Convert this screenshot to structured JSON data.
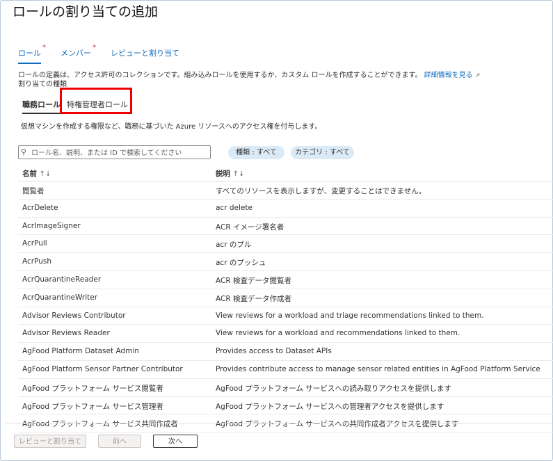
{
  "header": {
    "title": "ロールの割り当ての追加",
    "more": "…"
  },
  "tabs": [
    {
      "label": "ロール",
      "required": "*"
    },
    {
      "label": "メンバー",
      "required": "*"
    },
    {
      "label": "レビューと割り当て",
      "required": ""
    }
  ],
  "description": {
    "text": "ロールの定義は、アクセス許可のコレクションです。組み込みロールを使用するか、カスタム ロールを作成することができます。",
    "link": "詳細情報を見る",
    "link_icon": "external-link-icon"
  },
  "assignment_type_label": "割り当ての種類",
  "subtabs": [
    {
      "label": "職務ロール"
    },
    {
      "label": "特権管理者ロール"
    }
  ],
  "sub_description": "仮想マシンを作成する権限など、職務に基づいた Azure リソースへのアクセス権を付与します。",
  "search": {
    "placeholder": "ロール名、説明、または ID で検索してください",
    "icon": "search-icon"
  },
  "filters": [
    {
      "label": "種類 : すべて"
    },
    {
      "label": "カテゴリ : すべて"
    }
  ],
  "table": {
    "columns": [
      {
        "label": "名前",
        "sort": "↑↓"
      },
      {
        "label": "説明",
        "sort": "↑↓"
      }
    ],
    "rows": [
      {
        "name": "閲覧者",
        "description": "すべてのリソースを表示しますが、変更することはできません。"
      },
      {
        "name": "AcrDelete",
        "description": "acr delete"
      },
      {
        "name": "AcrImageSigner",
        "description": "ACR イメージ署名者"
      },
      {
        "name": "AcrPull",
        "description": "acr のプル"
      },
      {
        "name": "AcrPush",
        "description": "acr のプッシュ"
      },
      {
        "name": "AcrQuarantineReader",
        "description": "ACR 検査データ閲覧者"
      },
      {
        "name": "AcrQuarantineWriter",
        "description": "ACR 検査データ作成者"
      },
      {
        "name": "Advisor Reviews Contributor",
        "description": "View reviews for a workload and triage recommendations linked to them."
      },
      {
        "name": "Advisor Reviews Reader",
        "description": "View reviews for a workload and recommendations linked to them."
      },
      {
        "name": "AgFood Platform Dataset Admin",
        "description": "Provides access to Dataset APIs"
      },
      {
        "name": "AgFood Platform Sensor Partner Contributor",
        "description": "Provides contribute access to manage sensor related entities in AgFood Platform Service"
      },
      {
        "name": "AgFood プラットフォーム サービス閲覧者",
        "description": "AgFood プラットフォーム サービスへの読み取りアクセスを提供します"
      },
      {
        "name": "AgFood プラットフォーム サービス管理者",
        "description": "AgFood プラットフォーム サービスへの管理者アクセスを提供します"
      },
      {
        "name": "AgFood プラットフォーム サービス共同作成者",
        "description": "AgFood プラットフォーム サービスへの共同作成者アクセスを提供します"
      }
    ]
  },
  "footer": {
    "review_button": "レビューと割り当て",
    "prev_button": "前へ",
    "next_button": "次へ"
  },
  "colors": {
    "accent": "#0f6cbd",
    "required": "#d13438",
    "highlight": "#ee0000",
    "pill": "#dbeaf7"
  }
}
